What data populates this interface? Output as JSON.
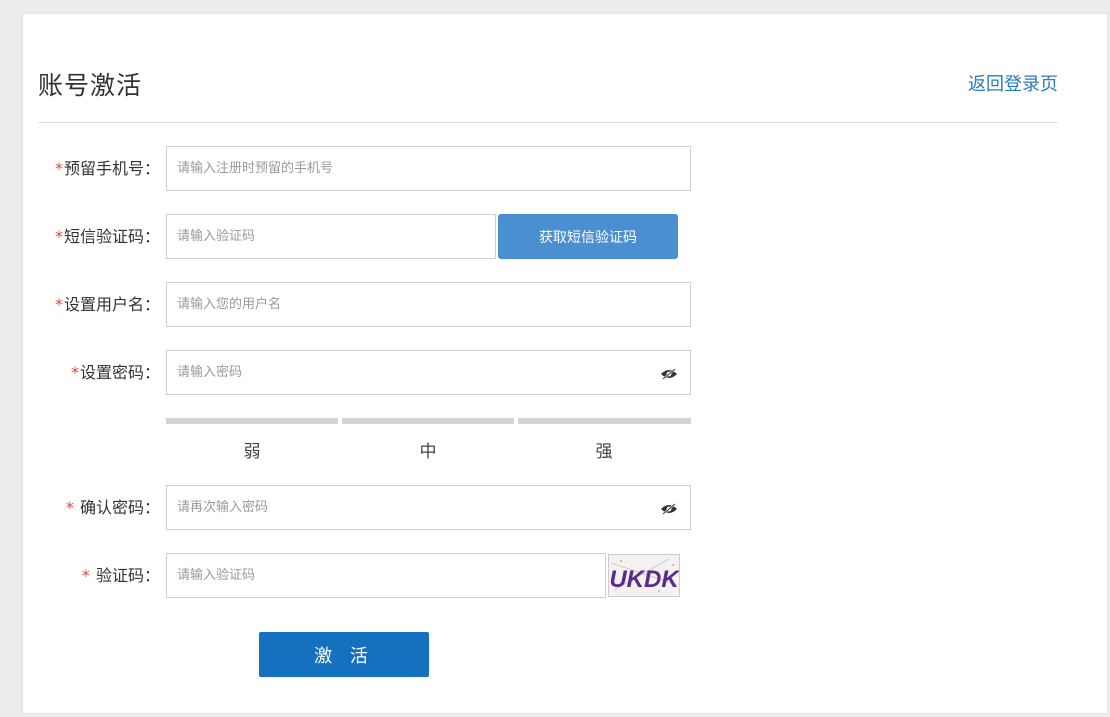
{
  "header": {
    "title": "账号激活",
    "back_link": "返回登录页"
  },
  "form": {
    "phone": {
      "required_mark": "*",
      "label": "预留手机号：",
      "placeholder": "请输入注册时预留的手机号"
    },
    "sms_code": {
      "required_mark": "*",
      "label": "短信验证码：",
      "placeholder": "请输入验证码",
      "button": "获取短信验证码"
    },
    "username": {
      "required_mark": "*",
      "label": "设置用户名：",
      "placeholder": "请输入您的用户名"
    },
    "password": {
      "required_mark": "*",
      "label": "设置密码：",
      "placeholder": "请输入密码",
      "toggle_icon": "eye-slash-icon"
    },
    "strength": {
      "weak": "弱",
      "medium": "中",
      "strong": "强"
    },
    "confirm_password": {
      "required_mark": "*",
      "label": " 确认密码：",
      "placeholder": "请再次输入密码",
      "toggle_icon": "eye-slash-icon"
    },
    "captcha": {
      "required_mark": "*",
      "label": " 验证码：",
      "placeholder": "请输入验证码",
      "image_text": "UKDK"
    },
    "submit": "激 活"
  },
  "colors": {
    "link": "#2a7bbd",
    "sms_button": "#4a8fd0",
    "submit_button": "#1570c0",
    "required": "#e0463d",
    "strength_bar": "#d4d4d4"
  }
}
